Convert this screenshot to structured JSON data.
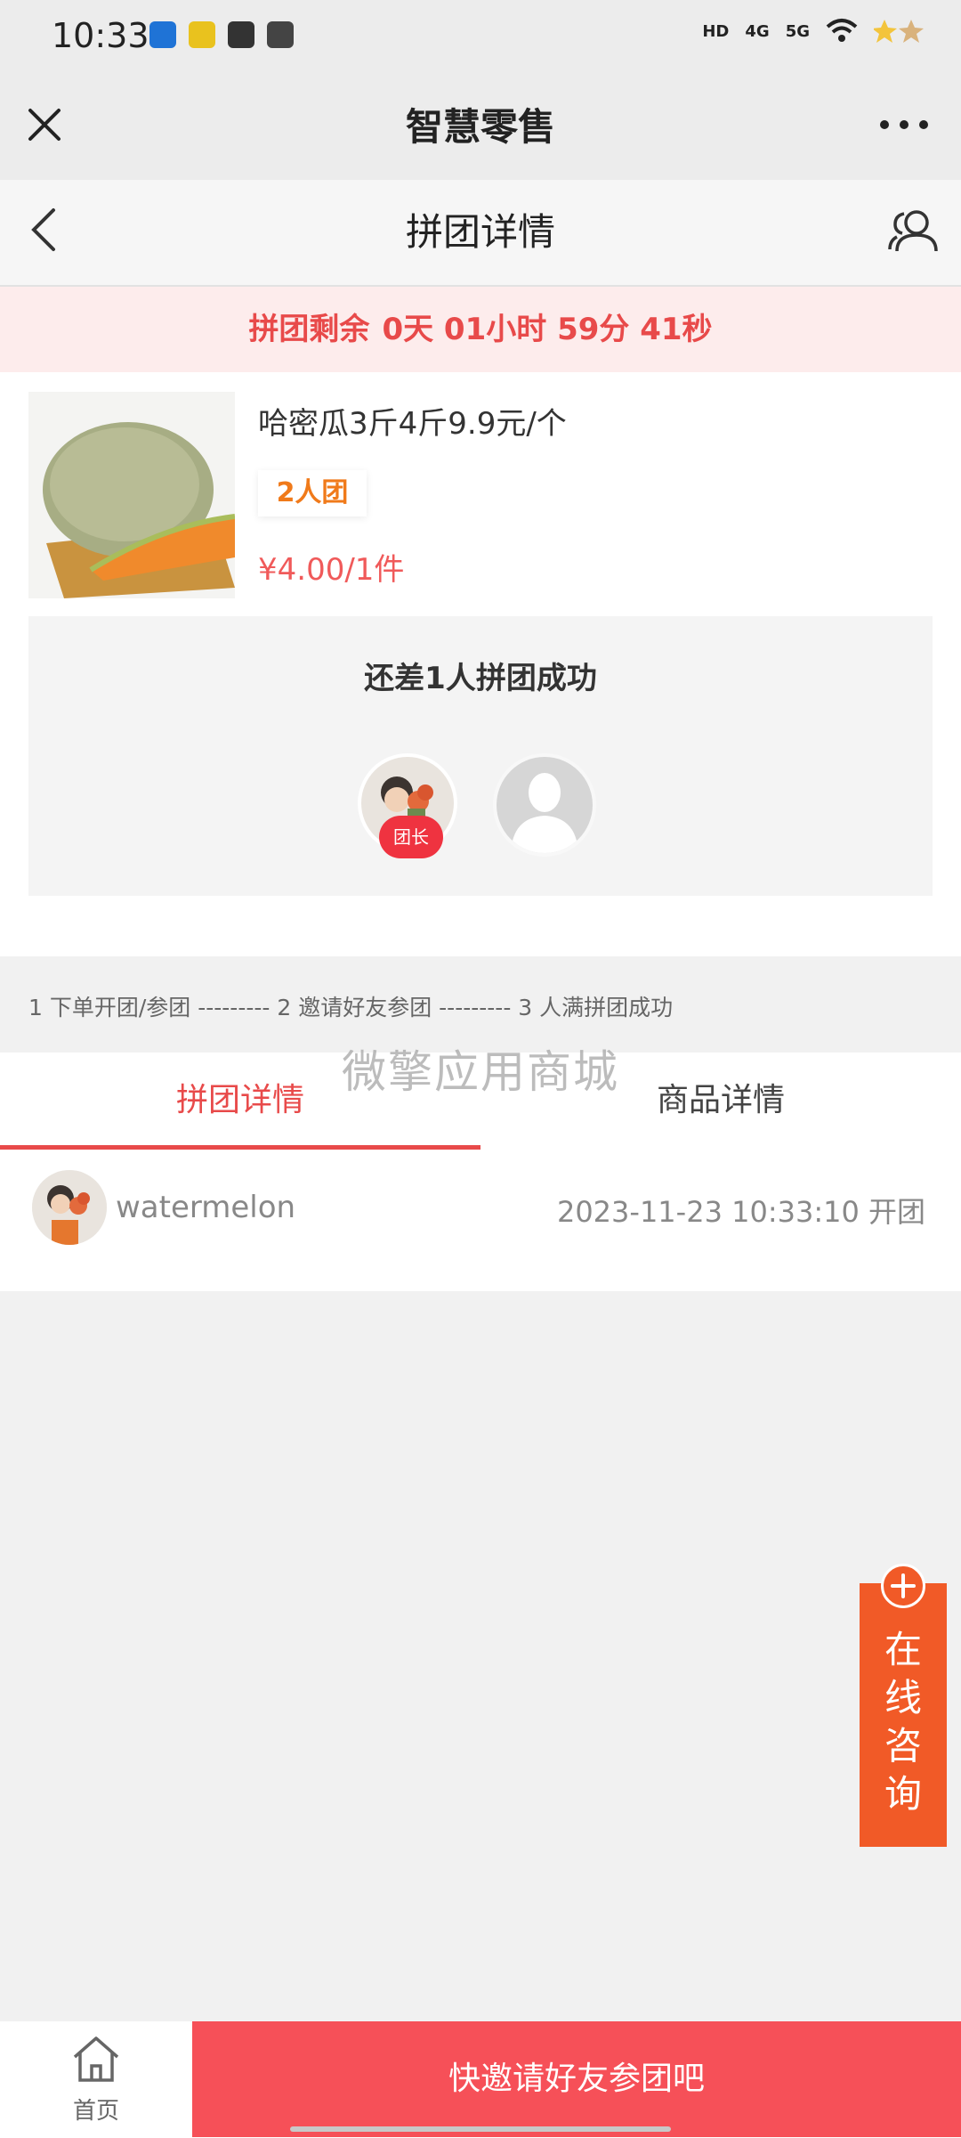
{
  "status_bar": {
    "time": "10:33",
    "network": [
      "HD",
      "4G",
      "5G"
    ]
  },
  "app_bar": {
    "title": "智慧零售"
  },
  "nav": {
    "title": "拼团详情"
  },
  "countdown": {
    "label": "拼团剩余",
    "remaining": "0天 01小时 59分 41秒"
  },
  "product": {
    "name": "哈密瓜3斤4斤9.9元/个",
    "group_size_tag": "2人团",
    "price": "¥4.00/1件"
  },
  "progress": {
    "message": "还差1人拼团成功",
    "leader_badge": "团长"
  },
  "steps": "1 下单开团/参团 --------- 2 邀请好友参团 --------- 3 人满拼团成功",
  "watermark": "微擎应用商城",
  "tabs": [
    {
      "label": "拼团详情",
      "active": true
    },
    {
      "label": "商品详情",
      "active": false
    }
  ],
  "members": [
    {
      "name": "watermelon",
      "time": "2023-11-23 10:33:10 开团"
    }
  ],
  "consult": {
    "label": "在线咨询"
  },
  "bottom": {
    "home_label": "首页",
    "invite_label": "快邀请好友参团吧"
  },
  "colors": {
    "accent": "#e84a4a",
    "invite": "#f65058",
    "consult": "#f15a27",
    "tag": "#f07a1a"
  }
}
